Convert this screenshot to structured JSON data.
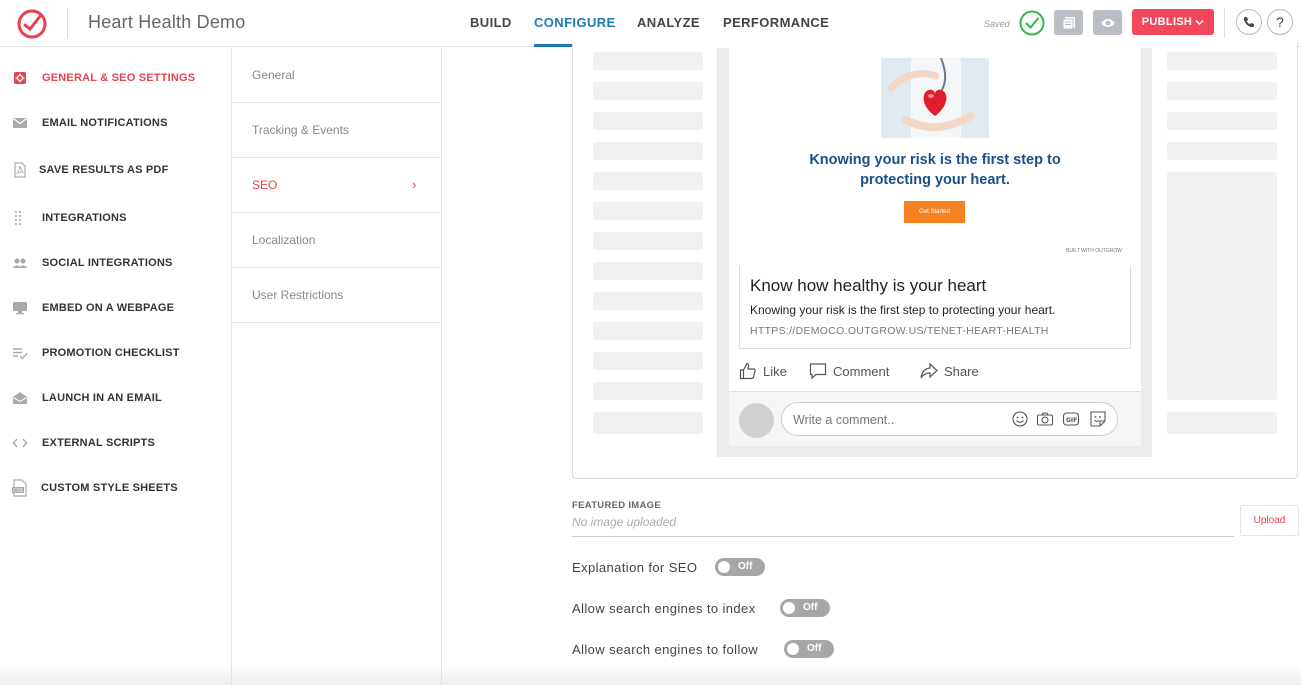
{
  "app": {
    "title": "Heart Health Demo"
  },
  "nav": {
    "tabs": [
      {
        "label": "BUILD"
      },
      {
        "label": "CONFIGURE"
      },
      {
        "label": "ANALYZE"
      },
      {
        "label": "PERFORMANCE"
      }
    ],
    "active_tab": "CONFIGURE"
  },
  "toolbar": {
    "saved_label": "Saved",
    "publish_label": "PUBLISH",
    "help_label": "?"
  },
  "sidebar": {
    "items": [
      {
        "label": "GENERAL & SEO SETTINGS",
        "icon": "settings-icon",
        "active": true
      },
      {
        "label": "EMAIL NOTIFICATIONS",
        "icon": "envelope-icon"
      },
      {
        "label": "SAVE RESULTS AS PDF",
        "icon": "pdf-icon"
      },
      {
        "label": "INTEGRATIONS",
        "icon": "grid-dots-icon"
      },
      {
        "label": "SOCIAL INTEGRATIONS",
        "icon": "people-icon"
      },
      {
        "label": "EMBED ON A WEBPAGE",
        "icon": "monitor-icon"
      },
      {
        "label": "PROMOTION CHECKLIST",
        "icon": "checklist-icon"
      },
      {
        "label": "LAUNCH IN AN EMAIL",
        "icon": "open-envelope-icon"
      },
      {
        "label": "EXTERNAL SCRIPTS",
        "icon": "code-icon"
      },
      {
        "label": "CUSTOM STYLE SHEETS",
        "icon": "css-file-icon"
      }
    ]
  },
  "submenu": {
    "items": [
      {
        "label": "General"
      },
      {
        "label": "Tracking & Events"
      },
      {
        "label": "SEO",
        "active": true
      },
      {
        "label": "Localization"
      },
      {
        "label": "User Restrictions"
      }
    ],
    "active_chevron": "›"
  },
  "preview": {
    "headline": "Knowing your risk is the first step to protecting your heart.",
    "cta": "Get Started",
    "tiny_badge": "BUILT WITH OUTGROW",
    "link_title": "Know how healthy is your heart",
    "link_description": "Knowing your risk is the first step to protecting your heart.",
    "link_url": "HTTPS://DEMOCO.OUTGROW.US/TENET-HEART-HEALTH",
    "actions": {
      "like": "Like",
      "comment": "Comment",
      "share": "Share"
    },
    "comment_placeholder": "Write a comment.."
  },
  "form": {
    "featured_image_label": "FEATURED IMAGE",
    "featured_image_value": "No image uploaded",
    "upload_label": "Upload",
    "toggles": [
      {
        "label": "Explanation for SEO",
        "state": "Off"
      },
      {
        "label": "Allow search engines to index",
        "state": "Off"
      },
      {
        "label": "Allow search engines to follow",
        "state": "Off"
      }
    ]
  },
  "colors": {
    "accent_red": "#e8414f",
    "publish_red": "#f2485a",
    "nav_blue": "#1c7bb5",
    "saved_green": "#2fb84d",
    "toggle_off": "#a6a6a6",
    "headline_blue": "#1a4f8b",
    "cta_orange": "#f58220"
  }
}
